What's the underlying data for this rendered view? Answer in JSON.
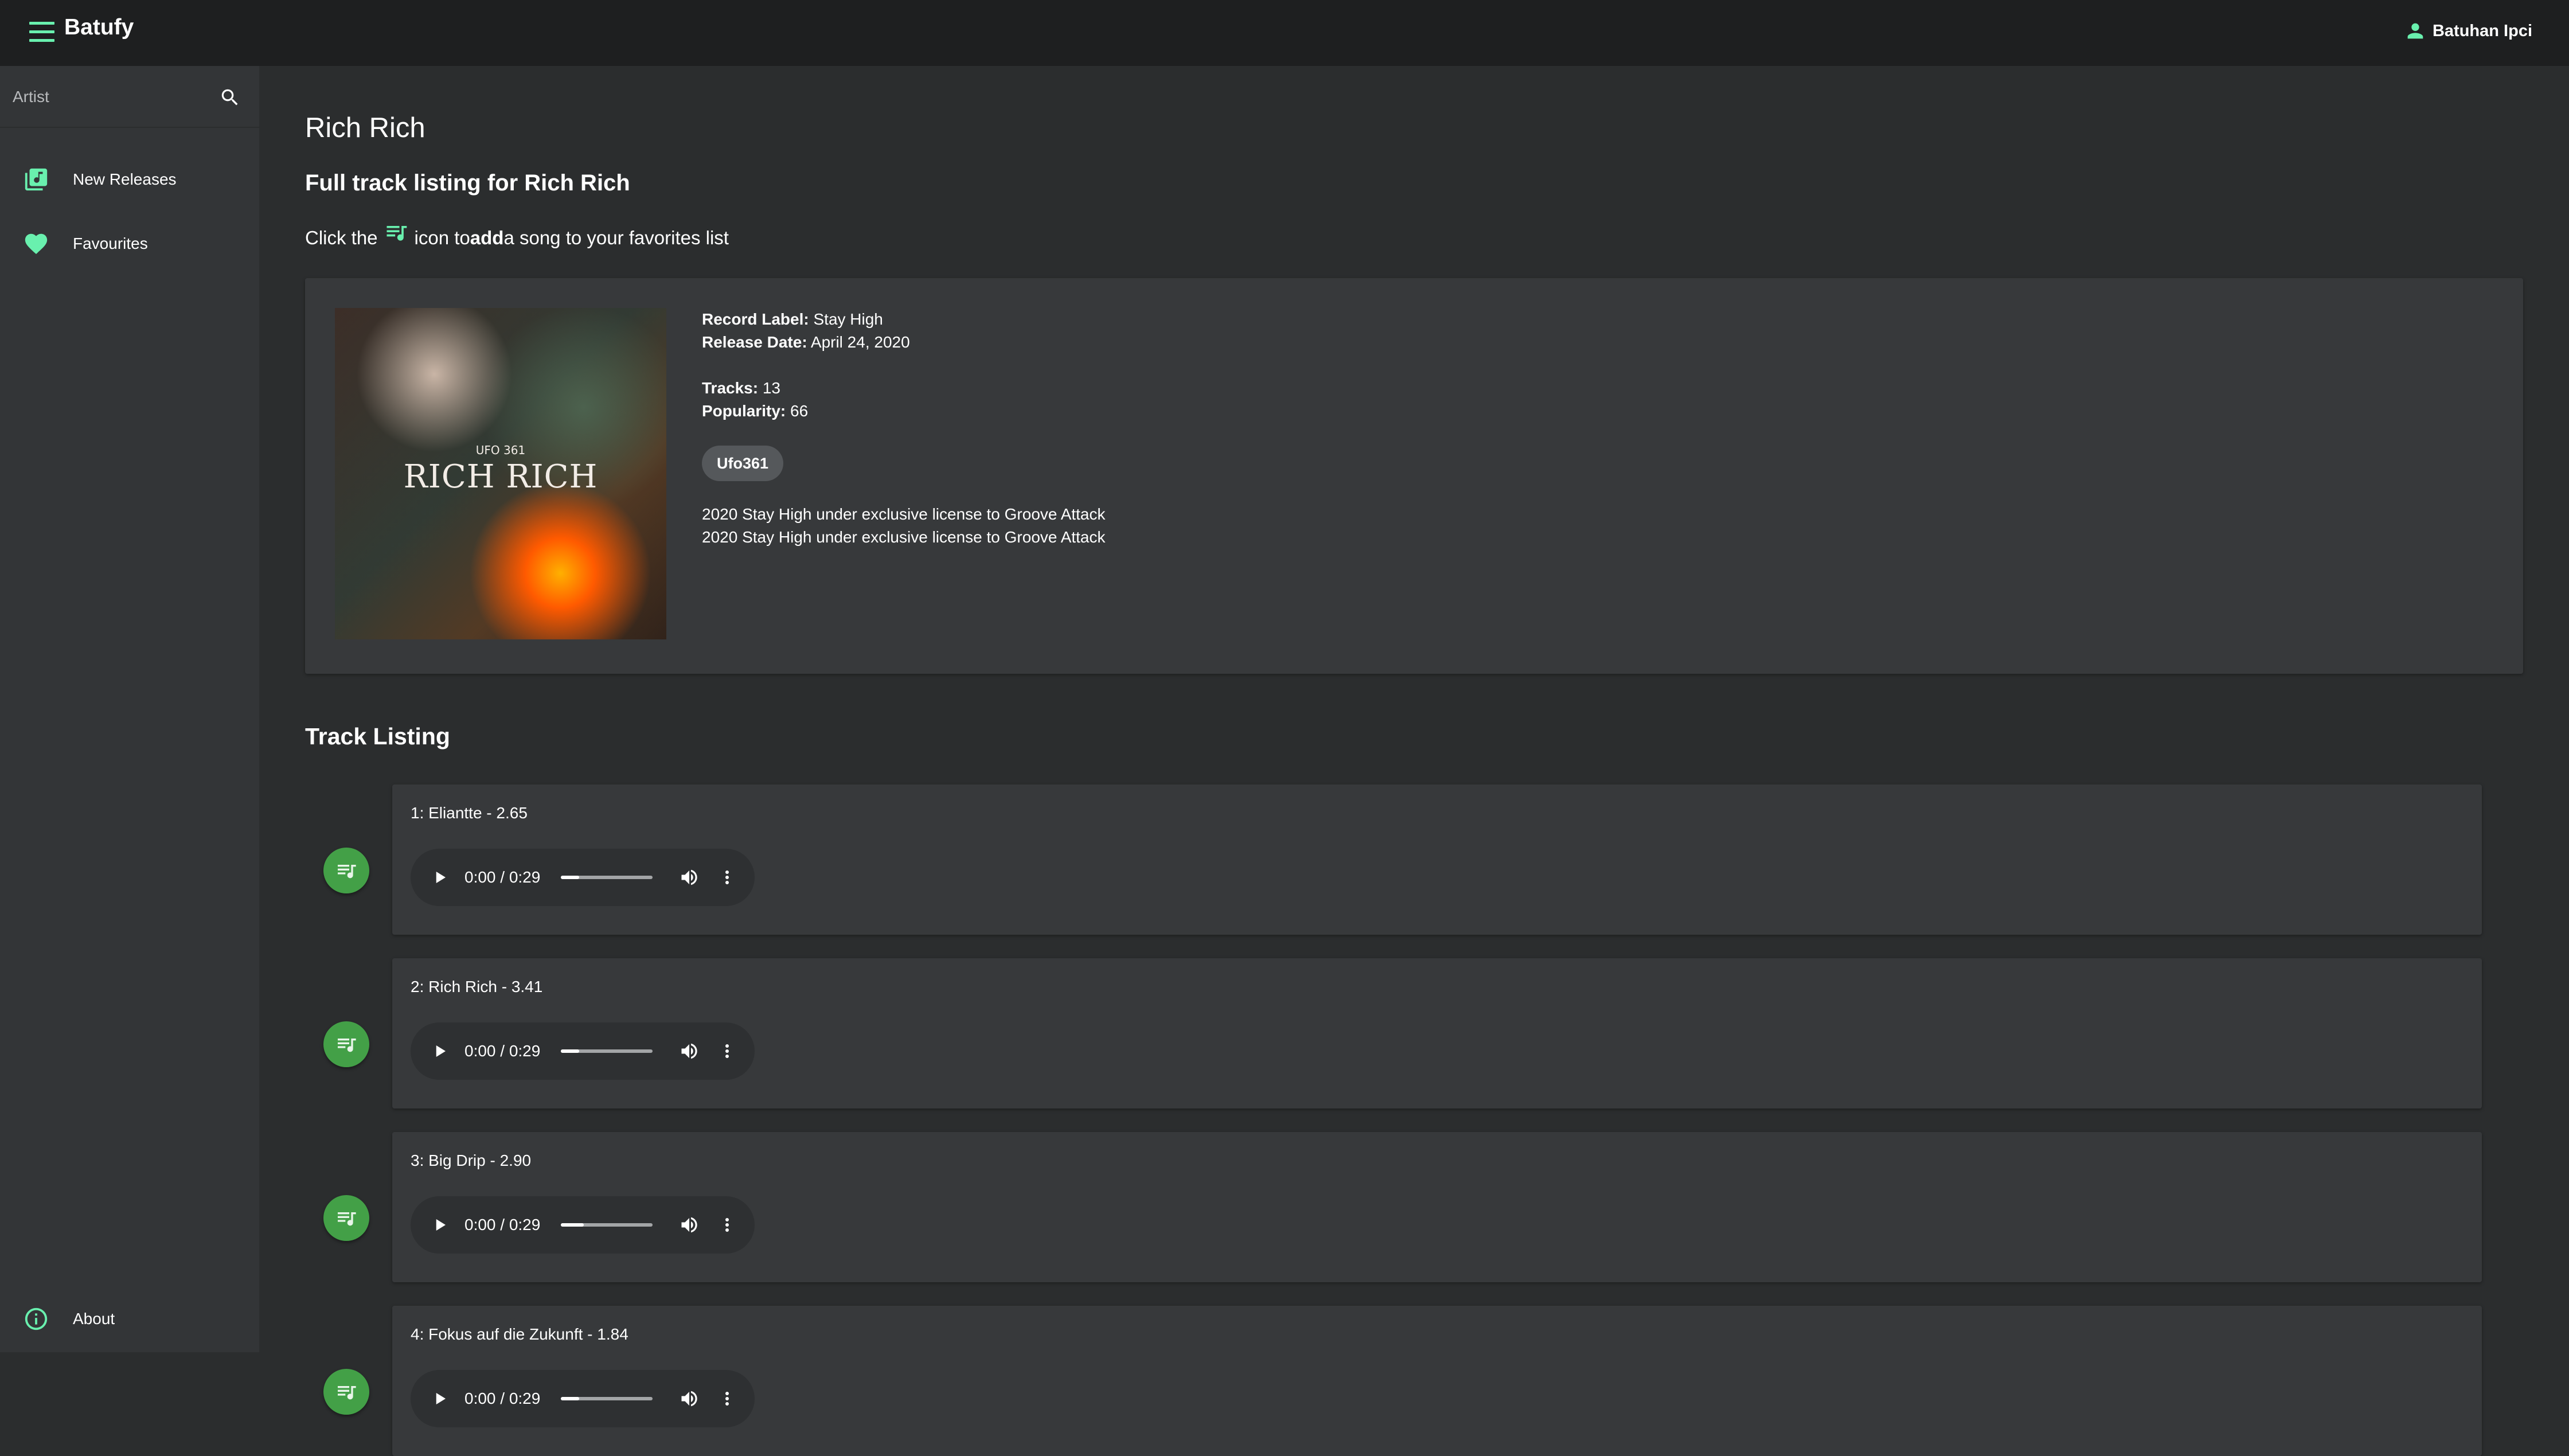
{
  "app": {
    "title": "Batufy"
  },
  "user": {
    "name": "Batuhan Ipci"
  },
  "search": {
    "placeholder": "Artist"
  },
  "sidebar": {
    "items": [
      {
        "label": "New Releases"
      },
      {
        "label": "Favourites"
      },
      {
        "label": "About"
      }
    ]
  },
  "page": {
    "title": "Rich Rich",
    "subtitle": "Full track listing for Rich Rich",
    "hint_pre": "Click the",
    "hint_mid": "icon to",
    "hint_bold": "add",
    "hint_post": "a song to your favorites list"
  },
  "album": {
    "cover_sub": "UFO 361",
    "cover_title": "RICH RICH",
    "record_label_key": "Record Label:",
    "record_label": "Stay High",
    "release_date_key": "Release Date:",
    "release_date": "April 24, 2020",
    "tracks_key": "Tracks:",
    "tracks": "13",
    "popularity_key": "Popularity:",
    "popularity": "66",
    "artist": "Ufo361",
    "copyrights": [
      "2020 Stay High under exclusive license to Groove Attack",
      "2020 Stay High under exclusive license to Groove Attack"
    ]
  },
  "track_listing": {
    "heading": "Track Listing",
    "tracks": [
      {
        "title": "1: Eliantte - 2.65",
        "time": "0:00 / 0:29",
        "progress": 0.2
      },
      {
        "title": "2: Rich Rich - 3.41",
        "time": "0:00 / 0:29",
        "progress": 0.2
      },
      {
        "title": "3: Big Drip - 2.90",
        "time": "0:00 / 0:29",
        "progress": 0.25
      },
      {
        "title": "4: Fokus auf die Zukunft - 1.84",
        "time": "0:00 / 0:29",
        "progress": 0.2
      }
    ]
  },
  "colors": {
    "accent": "#69f0ae",
    "fab": "#43a047",
    "background": "#2b2d2e",
    "topbar": "#1e1f20"
  }
}
